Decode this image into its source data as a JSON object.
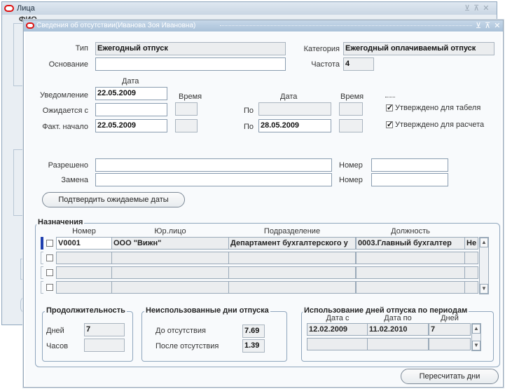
{
  "back_window": {
    "title": "Лица",
    "controls": "⊻ ⊼ ✕",
    "subtitle": "ФИО"
  },
  "dialog": {
    "title": "Сведения об отсутствии(Иванова Зоя Ивановна)",
    "controls": "⊻ ⊼ ✕"
  },
  "form": {
    "type_label": "Тип",
    "type_value": "Ежегодный отпуск",
    "category_label": "Категория",
    "category_value": "Ежегодный оплачиваемый отпуск",
    "basis_label": "Основание",
    "basis_value": "",
    "frequency_label": "Частота",
    "frequency_value": "4",
    "date_header": "Дата",
    "time_header": "Время",
    "date_header2": "Дата",
    "time_header2": "Время",
    "notify_label": "Уведомление",
    "notify_date": "22.05.2009",
    "expected_label": "Ожидается с",
    "expected_date": "",
    "actual_label": "Факт. начало",
    "actual_date": "22.05.2009",
    "to_label": "По",
    "to_label2": "По",
    "expected_to": "",
    "actual_to": "28.05.2009",
    "approved_timesheet": "Утверждено для табеля",
    "approved_payroll": "Утверждено для расчета",
    "authorized_label": "Разрешено",
    "authorized_value": "",
    "replacement_label": "Замена",
    "replacement_value": "",
    "number_label": "Номер",
    "number_label2": "Номер",
    "confirm_button": "Подтвердить ожидаемые даты"
  },
  "assignments": {
    "title": "Назначения",
    "columns": [
      "Номер",
      "Юр.лицо",
      "Подразделение",
      "Должность"
    ],
    "rows": [
      {
        "number": "V0001",
        "legal_entity": "ООО \"Вижн\"",
        "department": "Департамент бухгалтерского у",
        "position": "0003.Главный бухгалтер",
        "extra": "Не"
      },
      {
        "number": "",
        "legal_entity": "",
        "department": "",
        "position": "",
        "extra": ""
      },
      {
        "number": "",
        "legal_entity": "",
        "department": "",
        "position": "",
        "extra": ""
      },
      {
        "number": "",
        "legal_entity": "",
        "department": "",
        "position": "",
        "extra": ""
      }
    ]
  },
  "duration": {
    "title": "Продолжительность",
    "days_label": "Дней",
    "days_value": "7",
    "hours_label": "Часов",
    "hours_value": ""
  },
  "unused": {
    "title": "Неиспользованные дни отпуска",
    "before_label": "До отсутствия",
    "before_value": "7.69",
    "after_label": "После отсутствия",
    "after_value": "1.39"
  },
  "usage": {
    "title": "Использование дней отпуска по периодам",
    "col_from": "Дата с",
    "col_to": "Дата по",
    "col_days": "Дней",
    "rows": [
      {
        "from": "12.02.2009",
        "to": "11.02.2010",
        "days": "7"
      },
      {
        "from": "",
        "to": "",
        "days": ""
      }
    ]
  },
  "recalc_button": "Пересчитать дни",
  "colors": {
    "accent": "#1f3fae",
    "window_border": "#8fa6bd",
    "close_red": "#dd1111"
  }
}
